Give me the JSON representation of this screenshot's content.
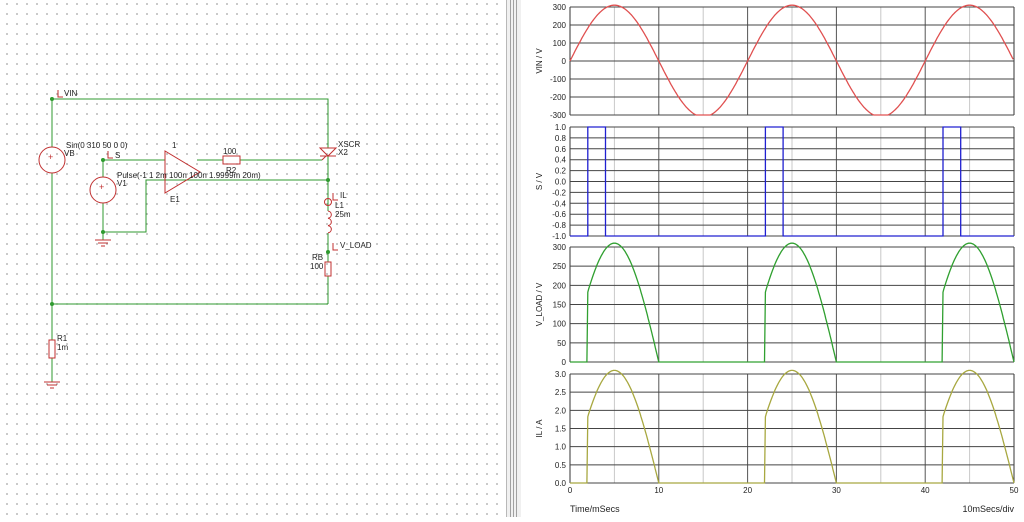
{
  "schematic": {
    "labels": {
      "vin": "VIN",
      "s": "S",
      "il": "IL",
      "vload": "V_LOAD",
      "vb_name": "VB",
      "vb_value": "Sin(0 310 50 0 0)",
      "v1_name": "V1",
      "v1_value": "Pulse(-1 1 2m 100n 100n 1.9999m 20m)",
      "e1_name": "E1",
      "e1_gain": "1",
      "r2_name": "R2",
      "r2_value": "100",
      "x2_name": "X2",
      "x2_model": "XSCR",
      "l1_name": "L1",
      "l1_value": "25m",
      "rb_name": "RB",
      "rb_value": "100",
      "r1_name": "R1",
      "r1_value": "1m"
    }
  },
  "plot_footer": {
    "xlabel": "Time/mSecs",
    "scale": "10mSecs/div"
  },
  "colors": {
    "vin": "#e05050",
    "s": "#2020d0",
    "vload": "#30a030",
    "il": "#a8a840",
    "wire": "#2f9a2f",
    "component": "#c03030"
  },
  "chart_data": [
    {
      "type": "line",
      "ylabel": "VIN / V",
      "xlim": [
        0,
        50
      ],
      "ylim": [
        -300,
        300
      ],
      "yticks": [
        "300",
        "200",
        "100",
        "0",
        "-100",
        "-200",
        "-300"
      ],
      "series": [
        {
          "name": "VIN",
          "function": "310*sin(2*pi*50*t)"
        }
      ]
    },
    {
      "type": "line",
      "ylabel": "S / V",
      "xlim": [
        0,
        50
      ],
      "ylim": [
        -1,
        1
      ],
      "yticks": [
        "1.0",
        "0.8",
        "0.6",
        "0.4",
        "0.2",
        "0.0",
        "-0.2",
        "-0.4",
        "-0.6",
        "-0.8",
        "-1.0"
      ],
      "series": [
        {
          "name": "S",
          "x": [
            0,
            2,
            2,
            4,
            4,
            22,
            22,
            24,
            24,
            42,
            42,
            44,
            44,
            50
          ],
          "y": [
            -1,
            -1,
            1,
            1,
            -1,
            -1,
            1,
            1,
            -1,
            -1,
            1,
            1,
            -1,
            -1
          ]
        }
      ]
    },
    {
      "type": "line",
      "ylabel": "V_LOAD / V",
      "xlim": [
        0,
        50
      ],
      "ylim": [
        0,
        300
      ],
      "yticks": [
        "300",
        "250",
        "200",
        "150",
        "100",
        "50",
        "0"
      ],
      "series": [
        {
          "name": "V_LOAD",
          "conduction_ms": [
            [
              2,
              10.2
            ],
            [
              22,
              30.2
            ],
            [
              42,
              50
            ]
          ],
          "peak": 310
        }
      ]
    },
    {
      "type": "line",
      "ylabel": "IL / A",
      "xlim": [
        0,
        50
      ],
      "ylim": [
        0,
        3
      ],
      "yticks": [
        "3.0",
        "2.5",
        "2.0",
        "1.5",
        "1.0",
        "0.5",
        "0.0"
      ],
      "series": [
        {
          "name": "IL",
          "conduction_ms": [
            [
              2,
              10.2
            ],
            [
              22,
              30.2
            ],
            [
              42,
              50
            ]
          ],
          "peak": 3.1
        }
      ]
    }
  ],
  "xticks": [
    "0",
    "10",
    "20",
    "30",
    "40",
    "50"
  ]
}
